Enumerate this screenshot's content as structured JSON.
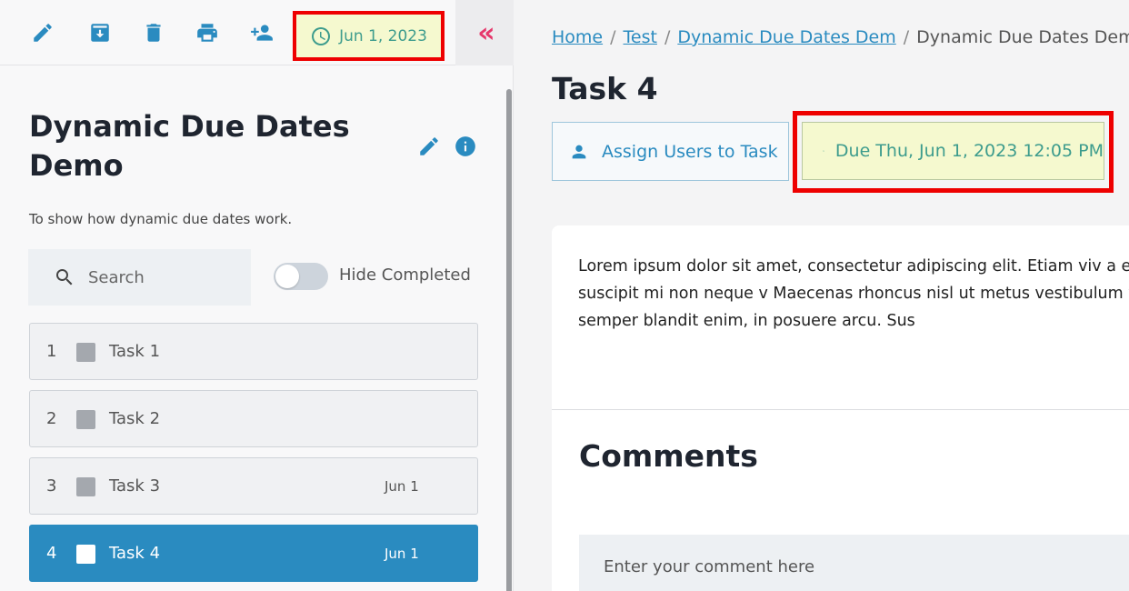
{
  "toolbar": {
    "icons": [
      "edit-icon",
      "archive-icon",
      "delete-icon",
      "print-icon",
      "add-user-icon"
    ],
    "date_chip": "Jun 1, 2023",
    "collapse_glyph": "«"
  },
  "project": {
    "title": "Dynamic Due Dates Demo",
    "description": "To show how dynamic due dates work."
  },
  "search": {
    "placeholder": "Search"
  },
  "hide_completed": {
    "label": "Hide Completed",
    "enabled": false
  },
  "tasks": [
    {
      "num": "1",
      "name": "Task 1",
      "due": ""
    },
    {
      "num": "2",
      "name": "Task 2",
      "due": ""
    },
    {
      "num": "3",
      "name": "Task 3",
      "due": "Jun 1"
    },
    {
      "num": "4",
      "name": "Task 4",
      "due": "Jun 1",
      "active": true
    }
  ],
  "breadcrumb": {
    "home": "Home",
    "test": "Test",
    "project": "Dynamic Due Dates Dem",
    "current": "Dynamic Due Dates Dem"
  },
  "task_detail": {
    "title": "Task 4",
    "assign_label": "Assign Users to Task",
    "due_label": "Due Thu, Jun 1, 2023 12:05 PM",
    "body": "Lorem ipsum dolor sit amet, consectetur adipiscing elit. Etiam viv a efficitur dolor malesuada. Pellentesque suscipit mi non neque v Maecenas rhoncus nisl ut metus vestibulum venenatis nec et nur vestibulum neque. Sed semper blandit enim, in posuere arcu. Sus"
  },
  "comments": {
    "title": "Comments",
    "placeholder": "Enter your comment here"
  },
  "colors": {
    "accent": "#2a8bc0",
    "due_text": "#3d9c8d",
    "due_bg": "#f5f9cf",
    "highlight_border": "#ee0000",
    "collapse": "#e6376b"
  }
}
